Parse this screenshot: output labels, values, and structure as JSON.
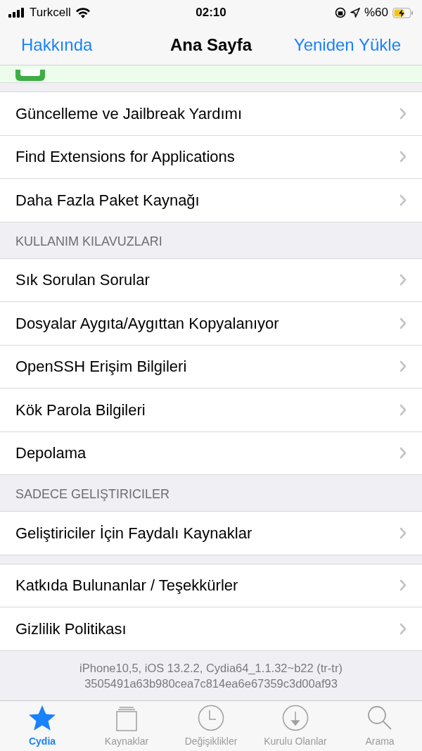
{
  "status_bar": {
    "carrier": "Turkcell",
    "time": "02:10",
    "battery": "%60"
  },
  "nav_bar": {
    "left": "Hakkında",
    "title": "Ana Sayfa",
    "right": "Yeniden Yükle"
  },
  "sections": [
    {
      "rows": [
        "Güncelleme ve Jailbreak Yardımı",
        "Find Extensions for Applications",
        "Daha Fazla Paket Kaynağı"
      ]
    },
    {
      "header": "KULLANIM KILAVUZLARI",
      "rows": [
        "Sık Sorulan Sorular",
        "Dosyalar Aygıta/Aygıttan Kopyalanıyor",
        "OpenSSH Erişim Bilgileri",
        "Kök Parola Bilgileri",
        "Depolama"
      ]
    },
    {
      "header": "SADECE GELIŞTIRICILER",
      "rows": [
        "Geliştiriciler İçin Faydalı Kaynaklar"
      ]
    },
    {
      "rows": [
        "Katkıda Bulunanlar / Teşekkürler",
        "Gizlilik Politikası"
      ]
    }
  ],
  "footer": [
    "iPhone10,5, iOS 13.2.2, Cydia64_1.1.32~b22 (tr-tr)",
    "3505491a63b980cea7c814ea6e67359c3d00af93"
  ],
  "tabs": [
    {
      "kind": "star",
      "label": "Cydia",
      "selected": true
    },
    {
      "kind": "stack",
      "label": "Kaynaklar",
      "selected": false
    },
    {
      "kind": "clock",
      "label": "Değişiklikler",
      "selected": false
    },
    {
      "kind": "download",
      "label": "Kurulu Olanlar",
      "selected": false
    },
    {
      "kind": "search",
      "label": "Arama",
      "selected": false
    }
  ]
}
